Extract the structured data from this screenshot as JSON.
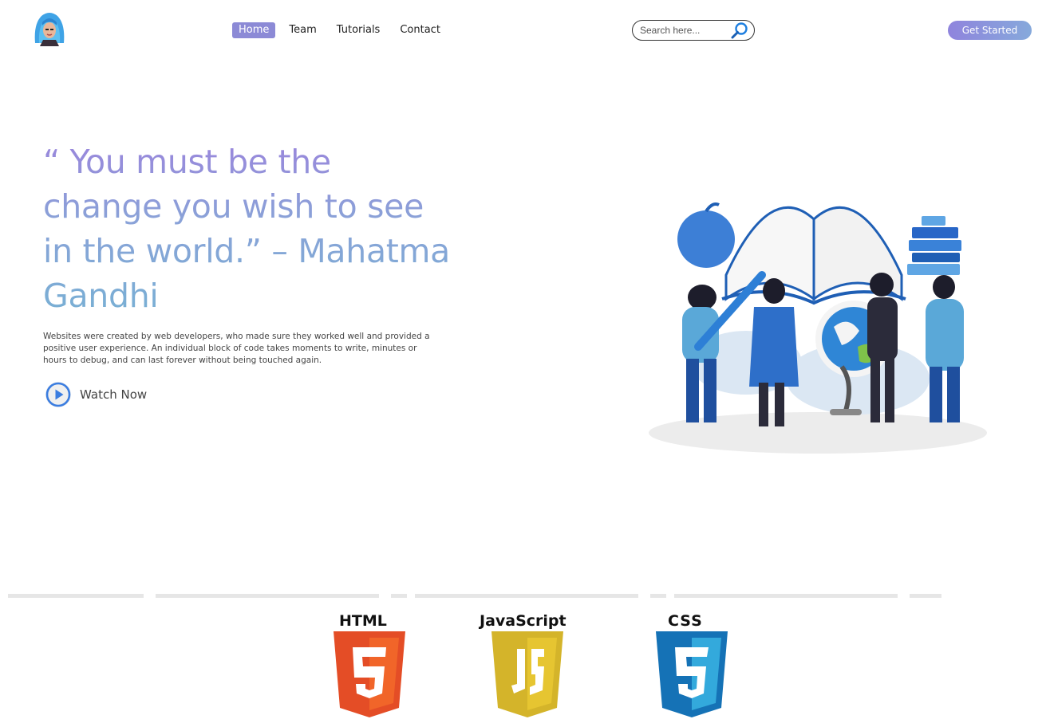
{
  "nav": {
    "links": [
      {
        "label": "Home",
        "active": true
      },
      {
        "label": "Team",
        "active": false
      },
      {
        "label": "Tutorials",
        "active": false
      },
      {
        "label": "Contact",
        "active": false
      }
    ],
    "search_placeholder": "Search here...",
    "cta_label": "Get Started"
  },
  "hero": {
    "quote": "“ You must be the change you wish to see in the world.” – Mahatma Gandhi",
    "description": "Websites were created by web developers, who made sure they worked well and provided a positive user experience. An individual block of code takes moments to write, minutes or hours to debug, and can last forever without being touched again.",
    "watch_label": "Watch Now"
  },
  "tech": {
    "html": "HTML",
    "js": "JavaScript",
    "css": "CSS"
  },
  "colors": {
    "accent_purple": "#8c8ad6",
    "accent_blue": "#78b0d4",
    "html_orange": "#e44d26",
    "js_yellow": "#e6c531",
    "css_blue": "#2965f1"
  },
  "icons": [
    "avatar-logo-icon",
    "search-icon",
    "play-circle-icon",
    "html5-shield-icon",
    "js-shield-icon",
    "css3-shield-icon"
  ]
}
